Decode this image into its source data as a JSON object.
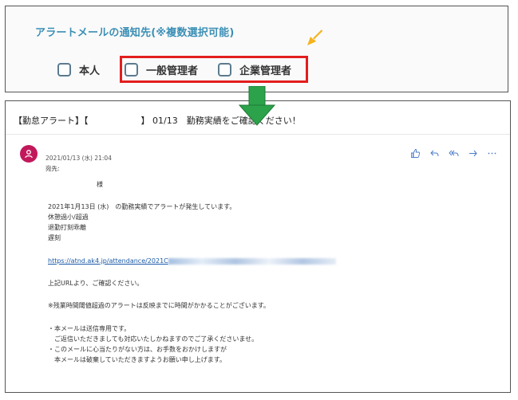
{
  "settings": {
    "title": "アラートメールの通知先(※複数選択可能)",
    "options": [
      {
        "label": "本人",
        "checked": false
      },
      {
        "label": "一般管理者",
        "checked": false
      },
      {
        "label": "企業管理者",
        "checked": false
      }
    ]
  },
  "email": {
    "subject": "【勤怠アラート】【　　　　　　】 01/13　勤務実績をご確認ください！",
    "date": "2021/01/13 (水) 21:04",
    "to_label": "宛先:",
    "salutation": "様",
    "body": {
      "line1": "2021年1月13日 (水)　の勤務実績でアラートが発生しています。",
      "line2": "休憩過小/超過",
      "line3": "退勤打刻乖離",
      "line4": "遅刻",
      "link": "https://atnd.ak4.jp/attendance/2021C",
      "line5": "上記URLより、ご確認ください。",
      "line6": "※残業時間閾値超過のアラートは反映までに時間がかかることがございます。",
      "line7": "・本メールは送信専用です。",
      "line8": "　ご返信いただきましても対応いたしかねますのでご了承くださいませ。",
      "line9": "・このメールに心当たりがない方は、お手数をおかけしますが",
      "line10": "　本メールは破棄していただきますようお願い申し上げます。"
    }
  },
  "colors": {
    "accent": "#3b8fb5",
    "highlight": "#e31d1d",
    "arrow_green": "#2ca24a",
    "arrow_orange": "#f5b21b",
    "avatar": "#c2185b"
  },
  "icons": [
    "like-icon",
    "reply-icon",
    "reply-all-icon",
    "forward-icon",
    "more-icon"
  ]
}
